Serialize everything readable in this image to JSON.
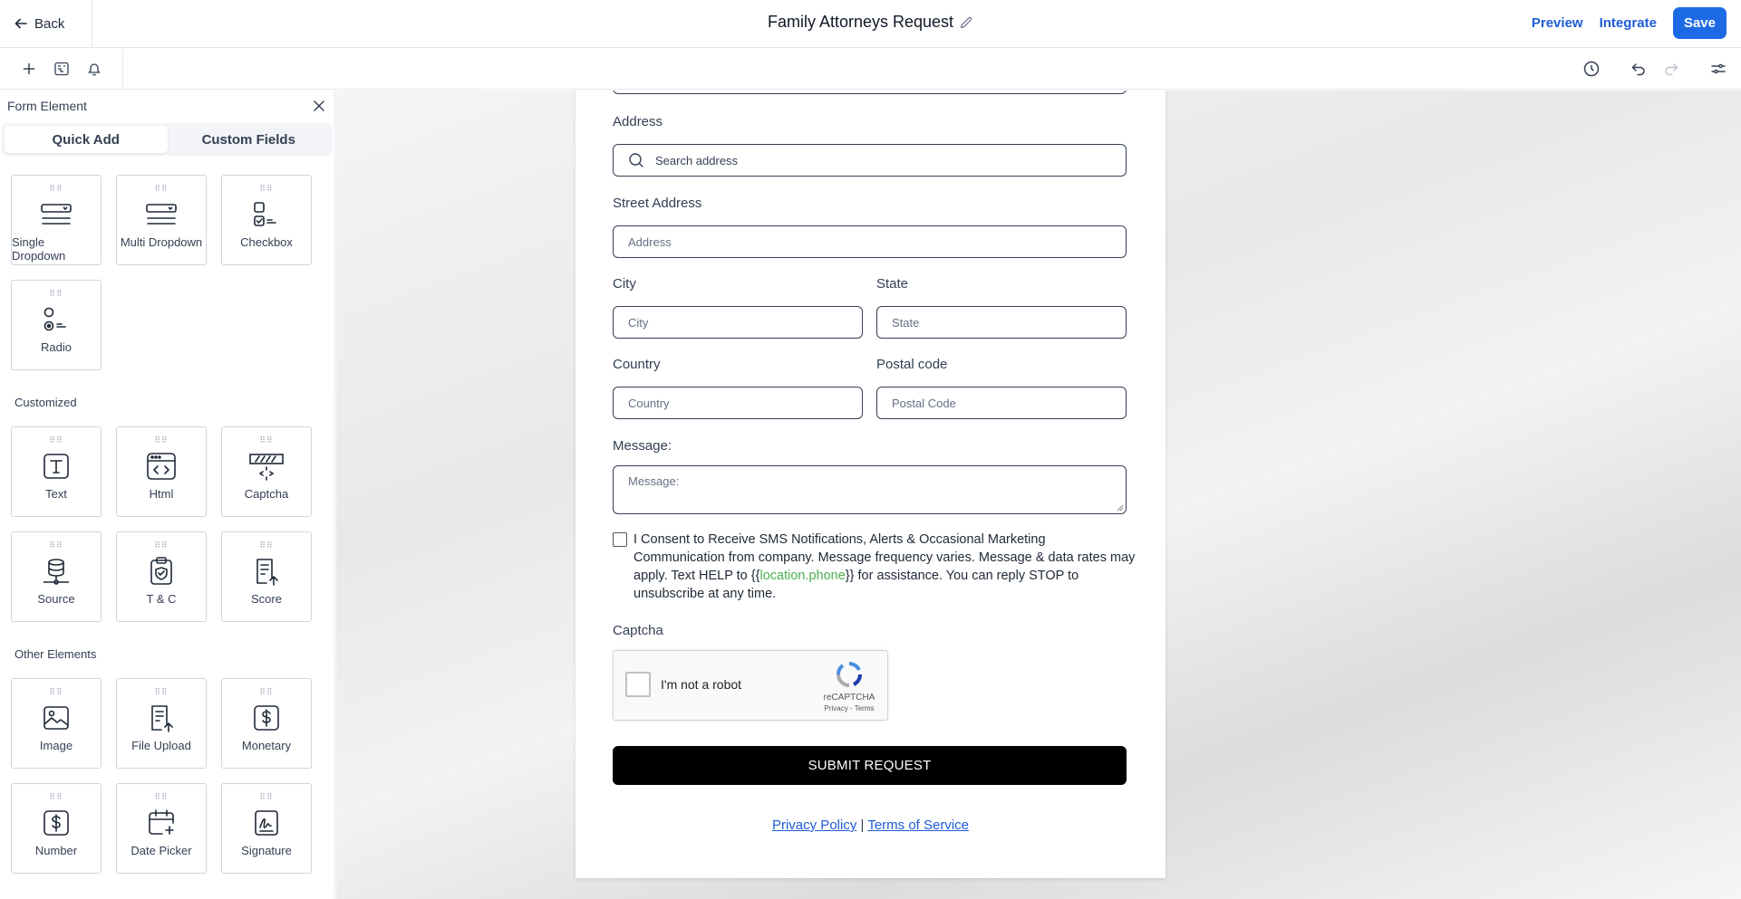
{
  "header": {
    "back_label": "Back",
    "form_title": "Family Attorneys Request",
    "preview_label": "Preview",
    "integrate_label": "Integrate",
    "save_label": "Save"
  },
  "sidebar": {
    "title": "Form Element",
    "tabs": [
      {
        "label": "Quick Add",
        "active": true
      },
      {
        "label": "Custom Fields",
        "active": false
      }
    ],
    "standard_items": [
      {
        "label": "Single Dropdown",
        "icon": "single-dropdown-icon"
      },
      {
        "label": "Multi Dropdown",
        "icon": "multi-dropdown-icon"
      },
      {
        "label": "Checkbox",
        "icon": "checkbox-icon"
      },
      {
        "label": "Radio",
        "icon": "radio-icon"
      }
    ],
    "customized_label": "Customized",
    "customized_items": [
      {
        "label": "Text",
        "icon": "text-icon"
      },
      {
        "label": "Html",
        "icon": "html-icon"
      },
      {
        "label": "Captcha",
        "icon": "captcha-icon"
      },
      {
        "label": "Source",
        "icon": "source-icon"
      },
      {
        "label": "T & C",
        "icon": "terms-icon"
      },
      {
        "label": "Score",
        "icon": "score-icon"
      }
    ],
    "other_label": "Other Elements",
    "other_items": [
      {
        "label": "Image",
        "icon": "image-icon"
      },
      {
        "label": "File Upload",
        "icon": "file-upload-icon"
      },
      {
        "label": "Monetary",
        "icon": "monetary-icon"
      },
      {
        "label": "Number",
        "icon": "number-icon"
      },
      {
        "label": "Date Picker",
        "icon": "date-picker-icon"
      },
      {
        "label": "Signature",
        "icon": "signature-icon"
      }
    ]
  },
  "form": {
    "address_label": "Address",
    "address_placeholder": "Search address",
    "street_label": "Street Address",
    "street_placeholder": "Address",
    "city_label": "City",
    "city_placeholder": "City",
    "state_label": "State",
    "state_placeholder": "State",
    "country_label": "Country",
    "country_placeholder": "Country",
    "postal_label": "Postal code",
    "postal_placeholder": "Postal Code",
    "message_label": "Message:",
    "message_placeholder": "Message:",
    "consent_before": "I Consent to Receive SMS Notifications, Alerts & Occasional Marketing Communication from company. Message frequency varies. Message & data rates may apply. Text HELP to {{",
    "consent_token": "location.phone",
    "consent_after": "}} for assistance. You can reply STOP to unsubscribe at any time.",
    "captcha_label": "Captcha",
    "captcha_checkbox_label": "I'm not a robot",
    "recaptcha_brand": "reCAPTCHA",
    "recaptcha_links": "Privacy - Terms",
    "submit_label": "SUBMIT REQUEST",
    "privacy_link": "Privacy Policy",
    "separator": "|",
    "terms_link": "Terms of Service"
  },
  "colors": {
    "accent": "#1d6ae5",
    "link": "#1e5bd8",
    "token": "#4caf50",
    "submit": "#000000"
  }
}
